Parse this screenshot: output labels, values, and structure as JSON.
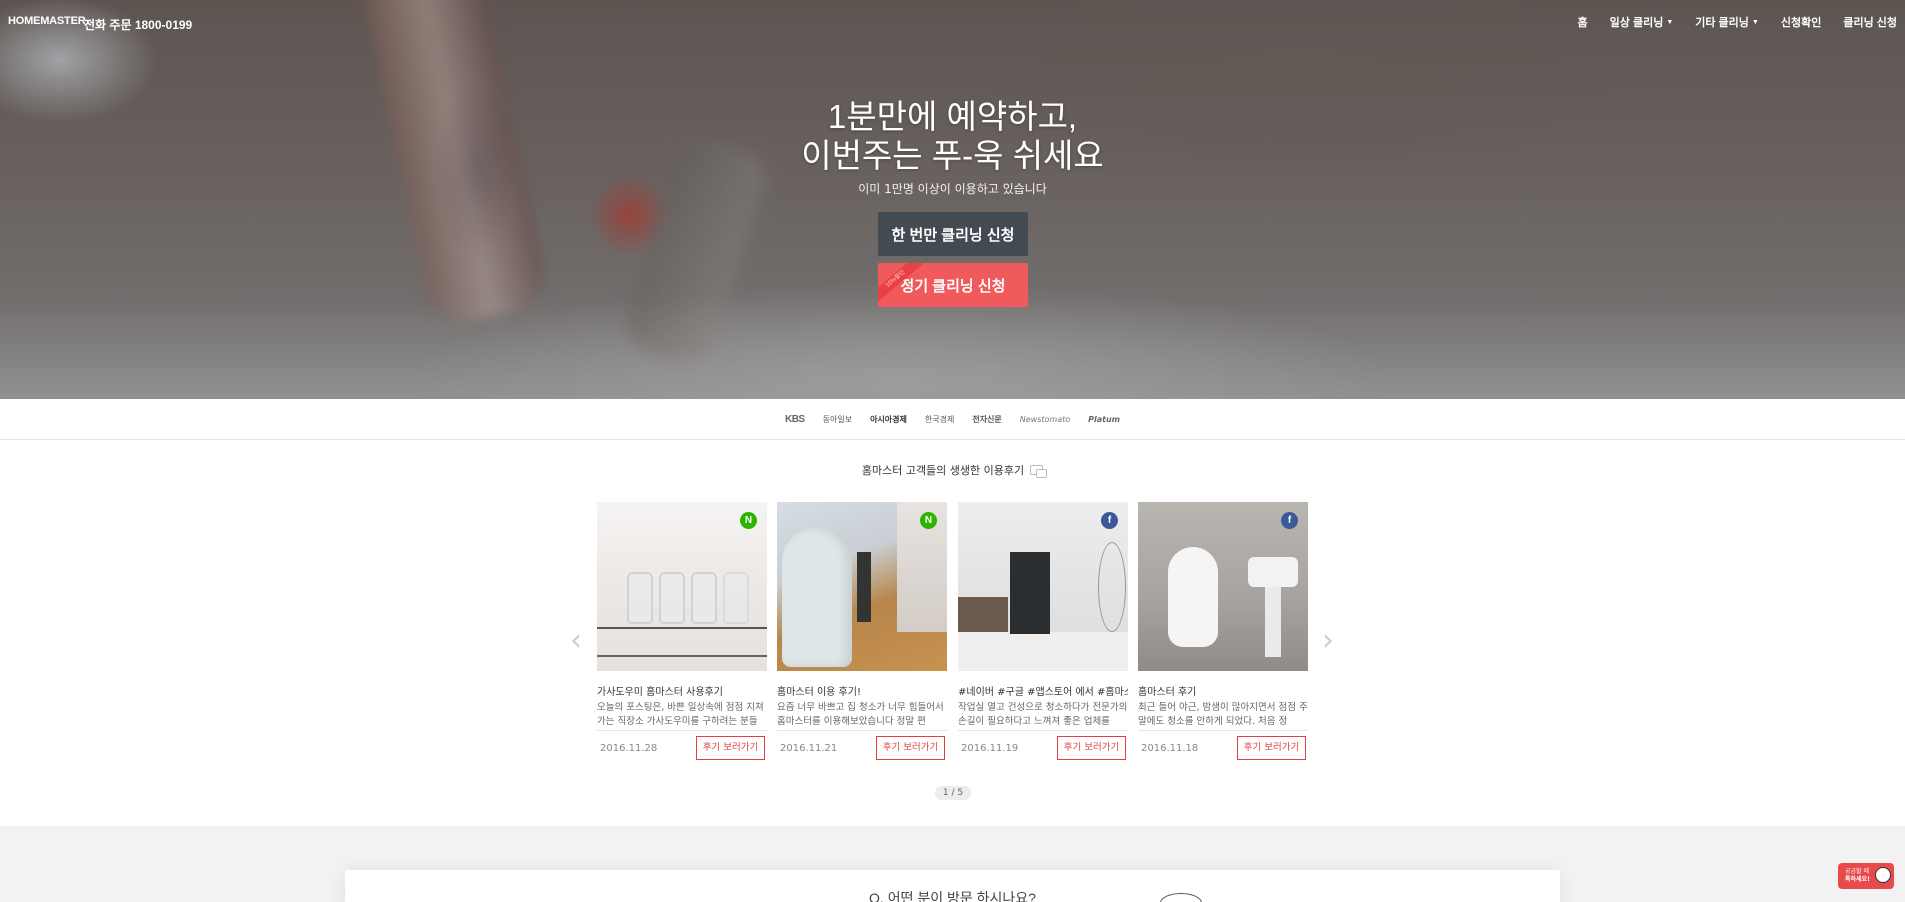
{
  "header": {
    "logo": "HOMEMASTER",
    "phone": "전화 주문 1800-0199",
    "nav": [
      {
        "label": "홈",
        "dropdown": false
      },
      {
        "label": "일상 클리닝",
        "dropdown": true
      },
      {
        "label": "기타 클리닝",
        "dropdown": true
      },
      {
        "label": "신청확인",
        "dropdown": false
      },
      {
        "label": "클리닝 신청",
        "dropdown": false
      }
    ]
  },
  "hero": {
    "title_line1": "1분만에 예약하고,",
    "title_line2": "이번주는 푸-욱 쉬세요",
    "subtitle": "이미 1만명 이상이 이용하고 있습니다",
    "btn_once": "한 번만 클리닝 신청",
    "btn_regular": "정기 클리닝 신청",
    "ribbon": "10%할인"
  },
  "press": [
    "KBS",
    "동아일보",
    "아시아경제",
    "한국경제",
    "전자신문",
    "Newstomato",
    "Platum"
  ],
  "reviews": {
    "title": "홈마스터 고객들의 생생한 이용후기",
    "link_label": "후기 보러가기",
    "items": [
      {
        "title": "가사도우미 홈마스터 사용후기",
        "excerpt": "오늘의 포스팅은, 바쁜 일상속에 점점 지쳐가는 직장소 가사도우미를 구하려는 분들",
        "date": "2016.11.28",
        "source": "N"
      },
      {
        "title": "홈마스터 이용 후기!",
        "excerpt": "요즘 너무 바쁘고 집 청소가 너무 힘들어서 홈마스터를 이용해보았습니다 정말 편",
        "date": "2016.11.21",
        "source": "N"
      },
      {
        "title": "#네이버 #구글 #앱스토어 에서 #홈마스터",
        "excerpt": "작업실 열고 건성으로 청소하다가 전문가의 손길이 필요하다고 느껴져 좋은 업체를",
        "date": "2016.11.19",
        "source": "f"
      },
      {
        "title": "홈마스터 후기",
        "excerpt": "최근 들어 야근, 밤샘이 많아지면서 점점 주말에도 청소를 안하게 되었다. 처음 정",
        "date": "2016.11.18",
        "source": "f"
      }
    ],
    "pager": "1 / 5"
  },
  "bottom": {
    "question": "Q. 어떤 분이 방문 하시나요?"
  },
  "chat_widget": {
    "line1": "궁금할 때",
    "line2": "톡하세요!"
  }
}
